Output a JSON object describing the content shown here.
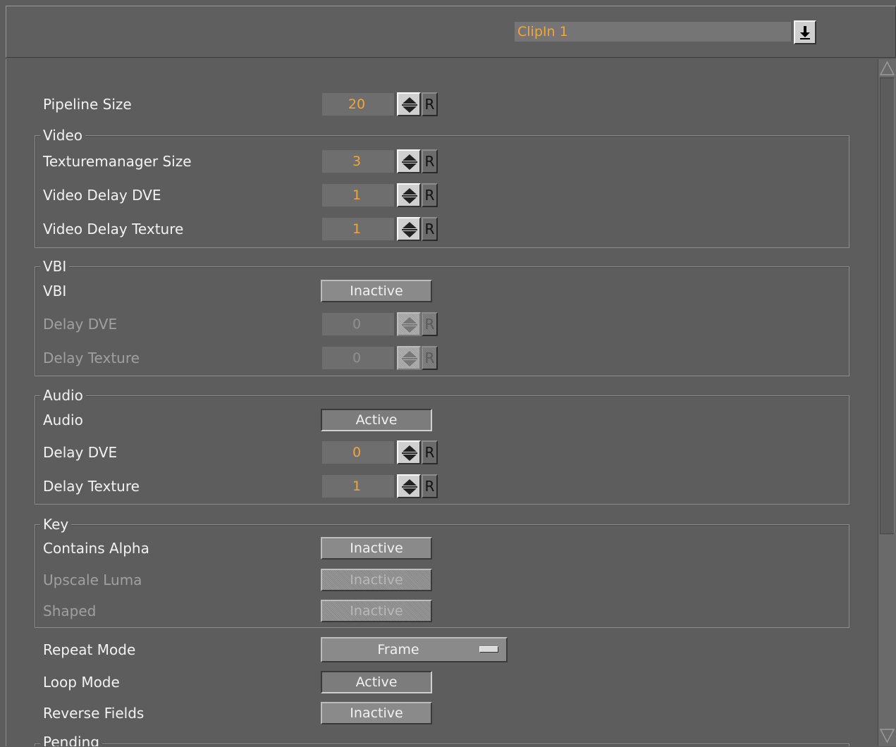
{
  "header": {
    "clip_selector": "ClipIn 1"
  },
  "pipeline": {
    "label": "Pipeline Size",
    "value": "20",
    "reset": "R"
  },
  "video": {
    "title": "Video",
    "texturemanager_size": {
      "label": "Texturemanager Size",
      "value": "3",
      "reset": "R"
    },
    "delay_dve": {
      "label": "Video Delay DVE",
      "value": "1",
      "reset": "R"
    },
    "delay_texture": {
      "label": "Video Delay Texture",
      "value": "1",
      "reset": "R"
    }
  },
  "vbi": {
    "title": "VBI",
    "vbi": {
      "label": "VBI",
      "state": "Inactive"
    },
    "delay_dve": {
      "label": "Delay DVE",
      "value": "0",
      "reset": "R"
    },
    "delay_texture": {
      "label": "Delay Texture",
      "value": "0",
      "reset": "R"
    }
  },
  "audio": {
    "title": "Audio",
    "audio": {
      "label": "Audio",
      "state": "Active"
    },
    "delay_dve": {
      "label": "Delay DVE",
      "value": "0",
      "reset": "R"
    },
    "delay_texture": {
      "label": "Delay Texture",
      "value": "1",
      "reset": "R"
    }
  },
  "key": {
    "title": "Key",
    "contains_alpha": {
      "label": "Contains Alpha",
      "state": "Inactive"
    },
    "upscale_luma": {
      "label": "Upscale Luma",
      "state": "Inactive"
    },
    "shaped": {
      "label": "Shaped",
      "state": "Inactive"
    }
  },
  "repeat_mode": {
    "label": "Repeat Mode",
    "value": "Frame"
  },
  "loop_mode": {
    "label": "Loop Mode",
    "state": "Active"
  },
  "reverse_fields": {
    "label": "Reverse Fields",
    "state": "Inactive"
  },
  "pending": {
    "title": "Pending"
  },
  "colors": {
    "value_text": "#f3a53a",
    "background": "#5d5d5d"
  }
}
